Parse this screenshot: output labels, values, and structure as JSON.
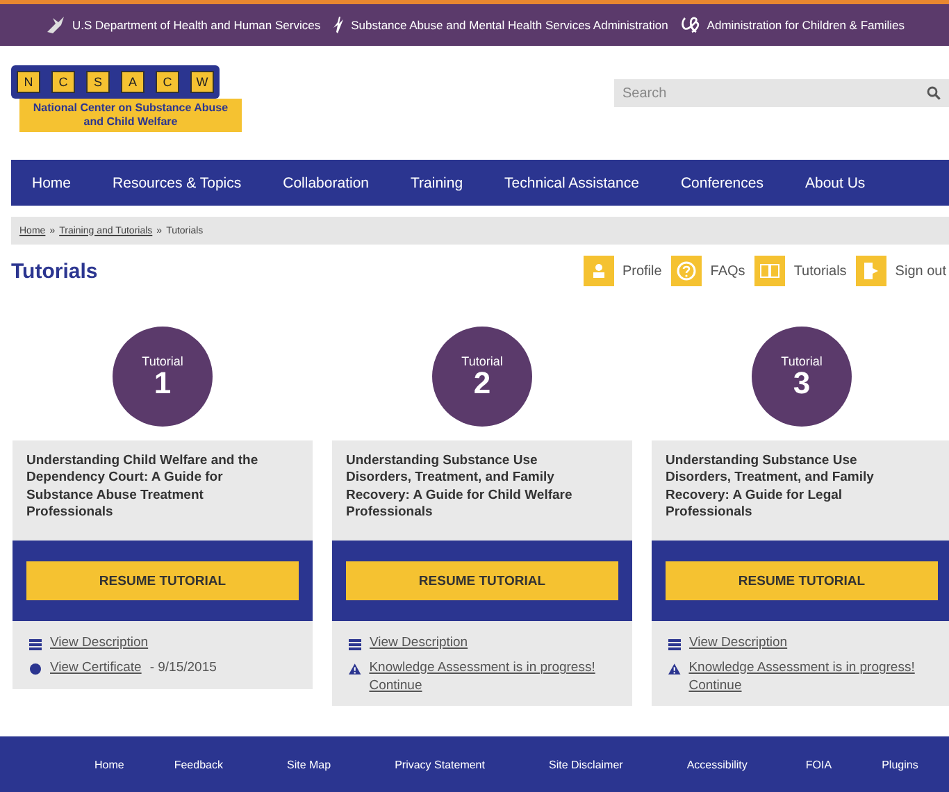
{
  "agency_bar": [
    {
      "label": "U.S Department of Health and Human Services",
      "kind": "hhs"
    },
    {
      "label": "Substance Abuse and Mental Health Services Administration",
      "kind": "samhsa"
    },
    {
      "label": "Administration for Children & Families",
      "kind": "acf"
    }
  ],
  "logo": {
    "letters": [
      "N",
      "C",
      "S",
      "A",
      "C",
      "W"
    ],
    "name": "National Center on Substance Abuse and Child Welfare"
  },
  "search": {
    "placeholder": "Search"
  },
  "nav": [
    {
      "label": "Home"
    },
    {
      "label": "Resources & Topics"
    },
    {
      "label": "Collaboration"
    },
    {
      "label": "Training"
    },
    {
      "label": "Technical Assistance"
    },
    {
      "label": "Conferences"
    },
    {
      "label": "About Us"
    }
  ],
  "breadcrumb": [
    {
      "label": "Home",
      "link": true
    },
    {
      "separator": "»",
      "label": "Training and Tutorials",
      "link": true
    },
    {
      "separator": "»",
      "label": "Tutorials",
      "link": false
    }
  ],
  "page_title": "Tutorials",
  "user_links": [
    {
      "label": "Profile",
      "kind": "profile"
    },
    {
      "label": "FAQs",
      "kind": "faq"
    },
    {
      "label": "Tutorials",
      "kind": "tutorials"
    },
    {
      "label": "Sign out",
      "kind": "signout"
    }
  ],
  "tutorials": [
    {
      "badge": "Tutorial",
      "number": "1",
      "title": "Understanding Child Welfare and the Dependency Court: A Guide for Substance Abuse Treatment Professionals",
      "button": "RESUME TUTORIAL",
      "links": [
        {
          "kind": "description",
          "label": "View Description"
        },
        {
          "kind": "certificate",
          "label": "View Certificate",
          "suffix": "- 9/15/2015"
        }
      ]
    },
    {
      "badge": "Tutorial",
      "number": "2",
      "title": "Understanding Substance Use Disorders, Treatment, and Family Recovery: A Guide for Child Welfare Professionals",
      "button": "RESUME TUTORIAL",
      "links": [
        {
          "kind": "description",
          "label": "View Description"
        },
        {
          "kind": "assessment",
          "label": "Knowledge Assessment is in progress! Continue"
        }
      ]
    },
    {
      "badge": "Tutorial",
      "number": "3",
      "title": "Understanding Substance Use Disorders, Treatment, and Family Recovery: A Guide for Legal Professionals",
      "button": "RESUME TUTORIAL",
      "links": [
        {
          "kind": "description",
          "label": "View Description"
        },
        {
          "kind": "assessment",
          "label": "Knowledge Assessment is in progress! Continue"
        }
      ]
    }
  ],
  "footer": [
    {
      "label": "Home"
    },
    {
      "label": "Feedback"
    },
    {
      "label": "Site Map"
    },
    {
      "label": "Privacy Statement"
    },
    {
      "label": "Site Disclaimer"
    },
    {
      "label": "Accessibility"
    },
    {
      "label": "FOIA"
    },
    {
      "label": "Plugins"
    }
  ]
}
